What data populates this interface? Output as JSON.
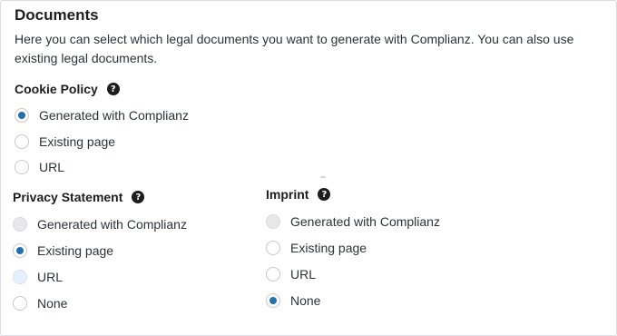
{
  "documents": {
    "title": "Documents",
    "description": "Here you can select which legal documents you want to generate with Complianz. You can also use existing legal documents."
  },
  "cookie_policy": {
    "label": "Cookie Policy",
    "help_icon": "question-circle-icon",
    "options": [
      {
        "label": "Generated with Complianz",
        "selected": true
      },
      {
        "label": "Existing page",
        "selected": false
      },
      {
        "label": "URL",
        "selected": false
      }
    ]
  },
  "privacy_statement": {
    "label": "Privacy Statement",
    "help_icon": "question-circle-icon",
    "options": [
      {
        "label": "Generated with Complianz",
        "selected": false
      },
      {
        "label": "Existing page",
        "selected": true
      },
      {
        "label": "URL",
        "selected": false
      },
      {
        "label": "None",
        "selected": false
      }
    ]
  },
  "imprint": {
    "label": "Imprint",
    "help_icon": "question-circle-icon",
    "options": [
      {
        "label": "Generated with Complianz",
        "selected": false
      },
      {
        "label": "Existing page",
        "selected": false
      },
      {
        "label": "URL",
        "selected": false
      },
      {
        "label": "None",
        "selected": true
      }
    ]
  },
  "colors": {
    "accent": "#2271b1",
    "text": "#1e1e1e",
    "border": "#dcdcde"
  }
}
